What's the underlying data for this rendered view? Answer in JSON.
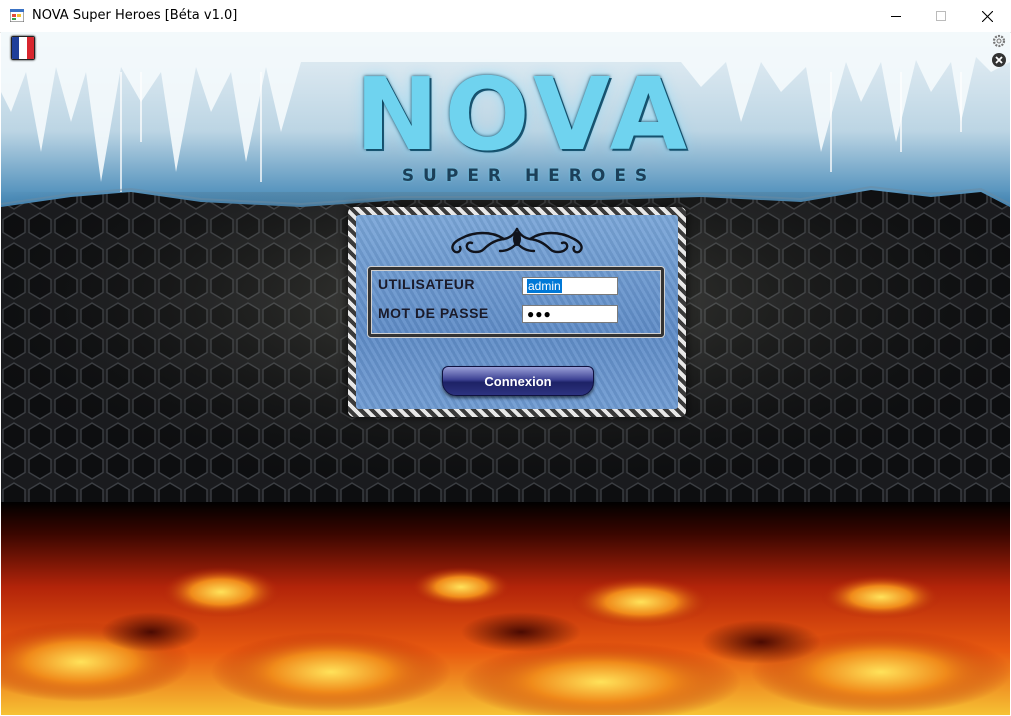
{
  "window": {
    "title": "NOVA Super Heroes [Béta v1.0]",
    "icon": "app-window-icon",
    "controls": [
      "minimize-icon",
      "maximize-icon",
      "close-icon"
    ]
  },
  "top_bar": {
    "language_flag": "france-flag-icon",
    "settings_icon": "gear-icon",
    "close_icon": "close-round-icon"
  },
  "logo": {
    "title": "NOVA",
    "subtitle": "SUPER HEROES"
  },
  "login": {
    "username_label": "UTILISATEUR",
    "username_value": "admin",
    "password_label": "MOT DE PASSE",
    "password_masked": "●●●",
    "submit_label": "Connexion"
  },
  "colors": {
    "logo_accent": "#6fd3ef",
    "panel_blue": "#6f9bd2",
    "button_blue": "#2d3380",
    "selection_blue": "#0078d7"
  }
}
